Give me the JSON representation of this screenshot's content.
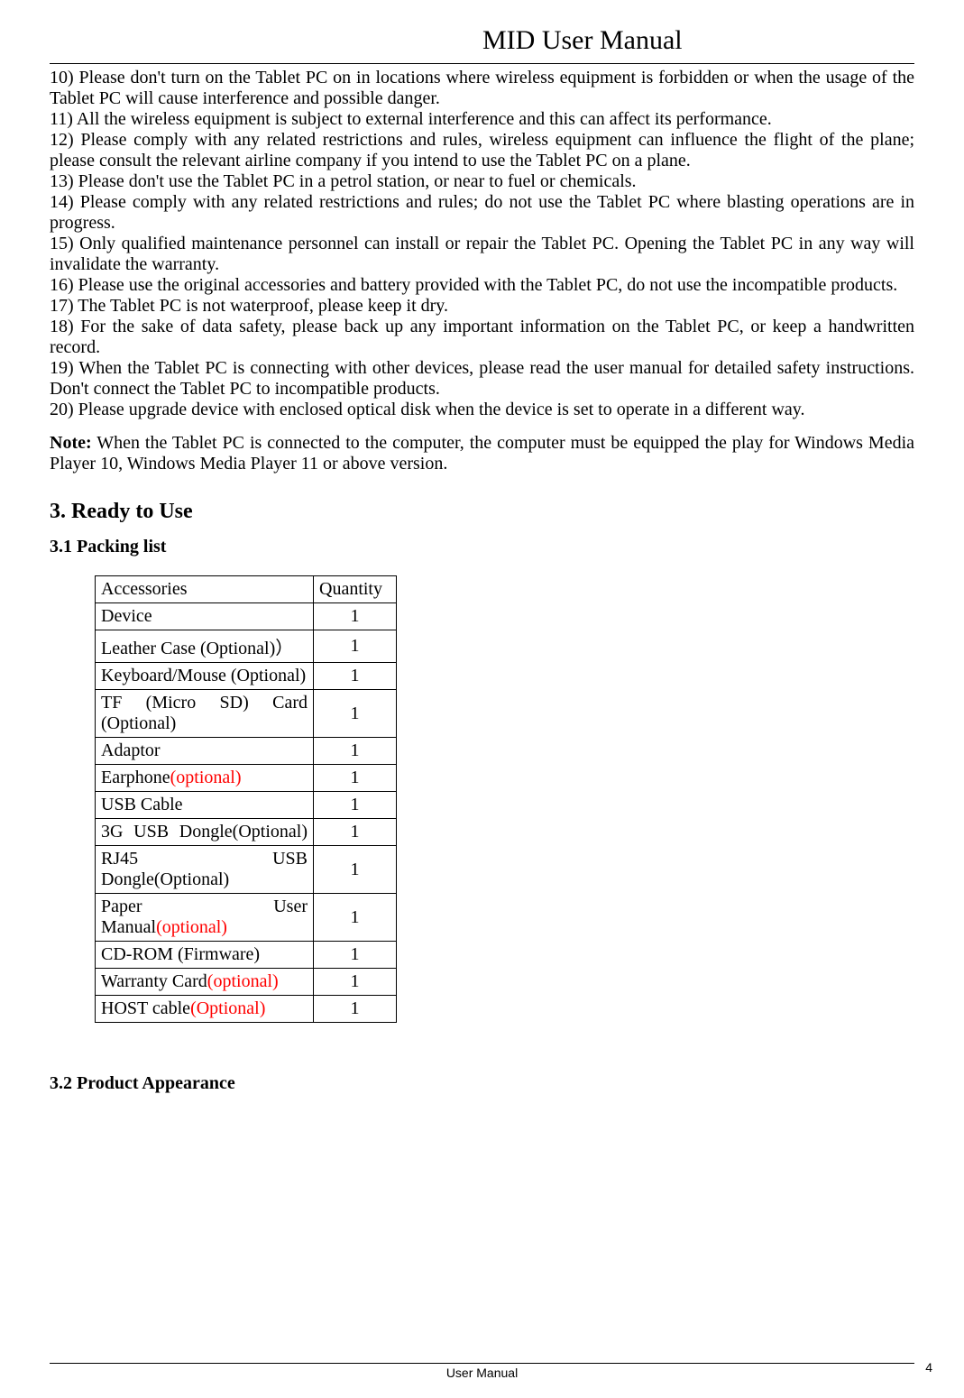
{
  "header": {
    "title": "MID User Manual"
  },
  "paragraphs": {
    "p10": "10) Please don't turn on the Tablet PC on in locations where wireless equipment is forbidden or when the usage of the Tablet PC will cause interference and possible danger.",
    "p11": "11) All the wireless equipment is subject to external interference and this can affect its performance.",
    "p12": "12) Please comply with any related restrictions and rules, wireless equipment can influence the flight of the plane; please consult the relevant airline company if you intend to use the Tablet PC on a plane.",
    "p13": "13) Please don't use the Tablet PC in a petrol station, or near to fuel or chemicals.",
    "p14": "14) Please comply with any related restrictions and rules; do not use the Tablet PC where blasting operations are in progress.",
    "p15": "15) Only qualified maintenance personnel can install or repair the Tablet PC. Opening the Tablet PC in any way will invalidate the warranty.",
    "p16": "16) Please use the original accessories and battery provided with the Tablet PC, do not use the incompatible products.",
    "p17": "17) The Tablet PC is not waterproof, please keep it dry.",
    "p18": "18) For the sake of data safety, please back up any important information on the Tablet PC, or keep a handwritten record.",
    "p19": "19) When the Tablet PC is connecting with other devices, please read the user manual for detailed safety instructions. Don't connect the Tablet PC to incompatible products.",
    "p20": "20) Please upgrade device with enclosed optical disk when the device is set to operate in a different way."
  },
  "note": {
    "label": "Note:",
    "text": " When the Tablet PC is connected to the computer, the computer must be equipped the play for Windows Media Player 10, Windows Media Player 11 or above version."
  },
  "sections": {
    "s3": "3. Ready to Use",
    "s31": "3.1 Packing list",
    "s32": "3.2 Product Appearance"
  },
  "table": {
    "header": {
      "acc": "Accessories",
      "qty": "Quantity"
    },
    "rows": [
      {
        "acc": "Device",
        "qty": "1",
        "plain": true
      },
      {
        "acc": "Leather Case (Optional)）",
        "qty": "1",
        "plain": true
      },
      {
        "acc": "Keyboard/Mouse (Optional)",
        "qty": "1",
        "plain": true
      },
      {
        "acc_pre": "TF (Micro SD) Card (Optional)",
        "qty": "1",
        "just": true
      },
      {
        "acc": "Adaptor",
        "qty": "1",
        "plain": true
      },
      {
        "acc_pre": "Earphone",
        "acc_red": "(optional)",
        "qty": "1",
        "plain": true
      },
      {
        "acc": "USB Cable",
        "qty": "1",
        "plain": true
      },
      {
        "acc_pre": "3G USB Dongle(Optional)",
        "qty": "1",
        "just": true
      },
      {
        "acc_pre": "RJ45 USB Dongle(Optional)",
        "qty": "1",
        "just": true
      },
      {
        "acc_pre": "Paper User Manual",
        "acc_red": "(optional)",
        "qty": "1",
        "just": true
      },
      {
        "acc": "CD-ROM (Firmware)",
        "qty": "1",
        "plain": true
      },
      {
        "acc_pre": "Warranty Card",
        "acc_red": "(optional)",
        "qty": "1",
        "plain": true
      },
      {
        "acc_pre": "HOST cable",
        "acc_red": "(Optional)",
        "qty": "1",
        "plain": true
      }
    ]
  },
  "footer": {
    "text": "User Manual",
    "page": "4"
  }
}
